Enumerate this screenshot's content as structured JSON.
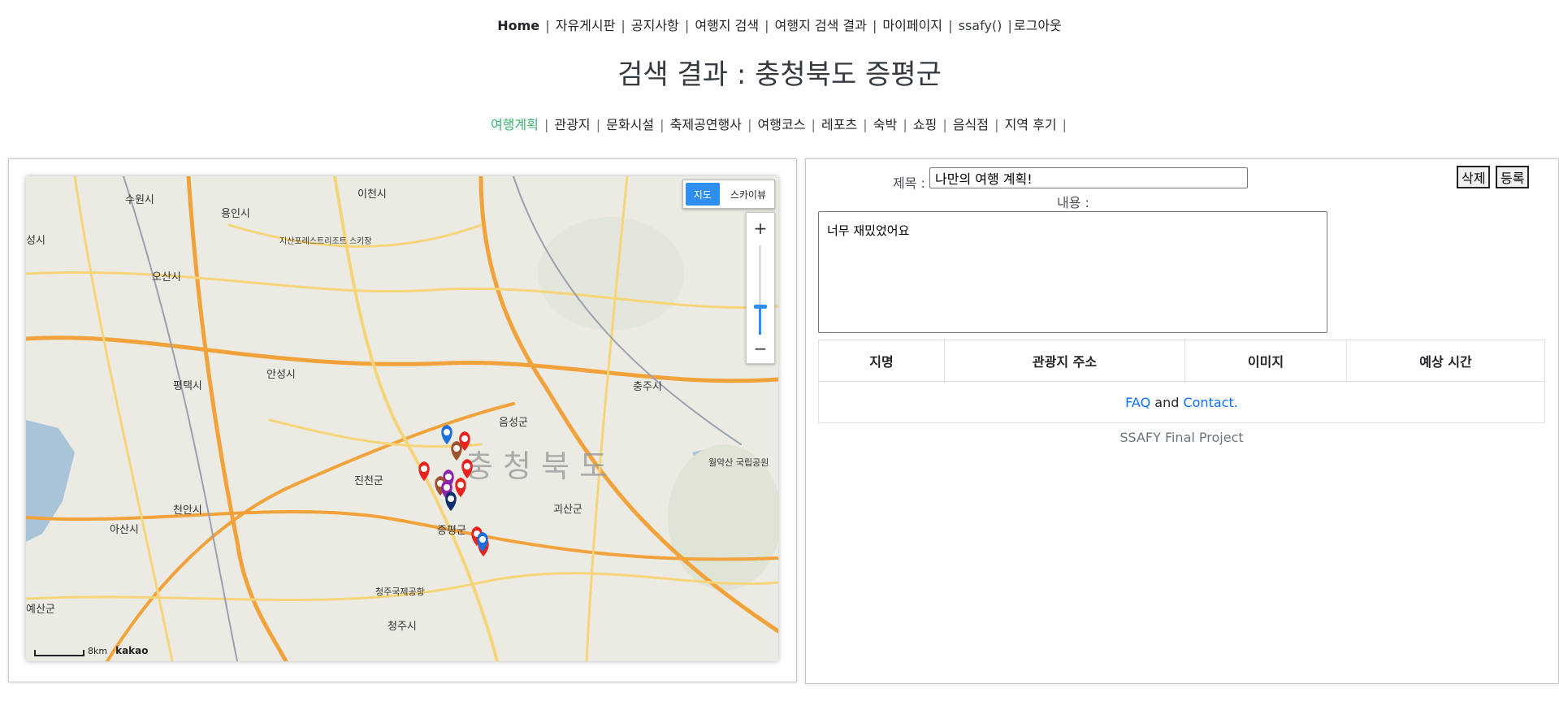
{
  "topnav": {
    "home": "Home",
    "free_board": "자유게시판",
    "notice": "공지사항",
    "travel_search": "여행지 검색",
    "travel_search_result": "여행지 검색 결과",
    "mypage": "마이페이지",
    "user": "ssafy()",
    "logout": "로그아웃"
  },
  "page_title": "검색 결과 : 충청북도 증평군",
  "subnav": {
    "items": [
      {
        "label": "여행계획",
        "active": true
      },
      {
        "label": "관광지"
      },
      {
        "label": "문화시설"
      },
      {
        "label": "축제공연행사"
      },
      {
        "label": "여행코스"
      },
      {
        "label": "레포츠"
      },
      {
        "label": "숙박"
      },
      {
        "label": "쇼핑"
      },
      {
        "label": "음식점"
      },
      {
        "label": "지역 후기"
      }
    ]
  },
  "map": {
    "type_map": "지도",
    "type_sky": "스카이뷰",
    "zoom_in": "+",
    "zoom_out": "−",
    "scale": "8km",
    "logo": "kakao",
    "province_label": "충 청 북 도",
    "place_labels": [
      "수원시",
      "용인시",
      "이천시",
      "오산시",
      "평택시",
      "안성시",
      "충주시",
      "음성군",
      "진천군",
      "천안시",
      "괴산군",
      "아산시",
      "증평군",
      "청주시",
      "청주국제공항",
      "월악산 국립공원",
      "지산포레스트리조트 스키장",
      "예산군",
      "성시"
    ],
    "colors": {
      "marker_red": "#e8231f",
      "marker_blue": "#1e6fd9",
      "marker_purple": "#8e24aa",
      "marker_brown": "#a0522d",
      "road_orange": "#f2a23a",
      "road_yellow": "#f6d57a"
    }
  },
  "form": {
    "title_label": "제목 :",
    "title_value": "나만의 여행 계획!",
    "content_label": "내용 :",
    "content_value": "너무 재밌었어요",
    "delete_label": "삭제",
    "register_label": "등록"
  },
  "table": {
    "headers": [
      "지명",
      "관광지 주소",
      "이미지",
      "예상 시간"
    ],
    "row_faq": "FAQ",
    "row_and": "and",
    "row_contact": "Contact."
  },
  "footer": "SSAFY Final Project"
}
